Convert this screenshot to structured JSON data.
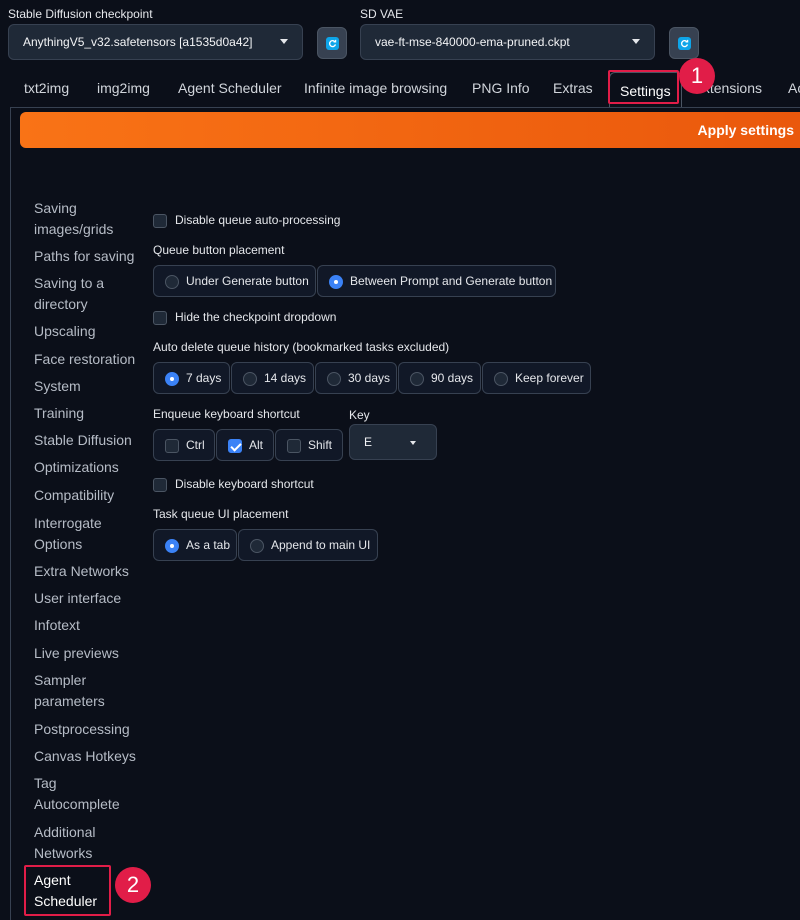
{
  "header": {
    "checkpoint_label": "Stable Diffusion checkpoint",
    "checkpoint_value": "AnythingV5_v32.safetensors [a1535d0a42]",
    "vae_label": "SD VAE",
    "vae_value": "vae-ft-mse-840000-ema-pruned.ckpt"
  },
  "tabs": [
    {
      "label": "txt2img"
    },
    {
      "label": "img2img"
    },
    {
      "label": "Agent Scheduler"
    },
    {
      "label": "Infinite image browsing"
    },
    {
      "label": "PNG Info"
    },
    {
      "label": "Extras"
    },
    {
      "label": "Settings"
    },
    {
      "label": "Extensions"
    },
    {
      "label": "Ac"
    }
  ],
  "annotations": {
    "badge1": "1",
    "badge2": "2"
  },
  "apply_label": "Apply settings",
  "sidebar": [
    "Saving images/grids",
    "Paths for saving",
    "Saving to a directory",
    "Upscaling",
    "Face restoration",
    "System",
    "Training",
    "Stable Diffusion",
    "Optimizations",
    "Compatibility",
    "Interrogate Options",
    "Extra Networks",
    "User interface",
    "Infotext",
    "Live previews",
    "Sampler parameters",
    "Postprocessing",
    "Canvas Hotkeys",
    "Tag Autocomplete",
    "Additional Networks",
    "Agent Scheduler"
  ],
  "settings": {
    "disable_queue": {
      "label": "Disable queue auto-processing",
      "checked": false
    },
    "queue_button_placement": {
      "label": "Queue button placement",
      "options": [
        "Under Generate button",
        "Between Prompt and Generate button"
      ],
      "selected": "Between Prompt and Generate button"
    },
    "hide_checkpoint": {
      "label": "Hide the checkpoint dropdown",
      "checked": false
    },
    "auto_delete": {
      "label": "Auto delete queue history (bookmarked tasks excluded)",
      "options": [
        "7 days",
        "14 days",
        "30 days",
        "90 days",
        "Keep forever"
      ],
      "selected": "7 days"
    },
    "shortcut": {
      "label": "Enqueue keyboard shortcut",
      "ctrl": "Ctrl",
      "alt": "Alt",
      "shift": "Shift",
      "ctrl_checked": false,
      "alt_checked": true,
      "shift_checked": false,
      "key_label": "Key",
      "key_value": "E"
    },
    "disable_shortcut": {
      "label": "Disable keyboard shortcut",
      "checked": false
    },
    "task_queue_placement": {
      "label": "Task queue UI placement",
      "options": [
        "As a tab",
        "Append to main UI"
      ],
      "selected": "As a tab"
    }
  },
  "colors": {
    "accent": "#f97316",
    "highlight": "#e11d48",
    "check": "#3b82f6"
  }
}
